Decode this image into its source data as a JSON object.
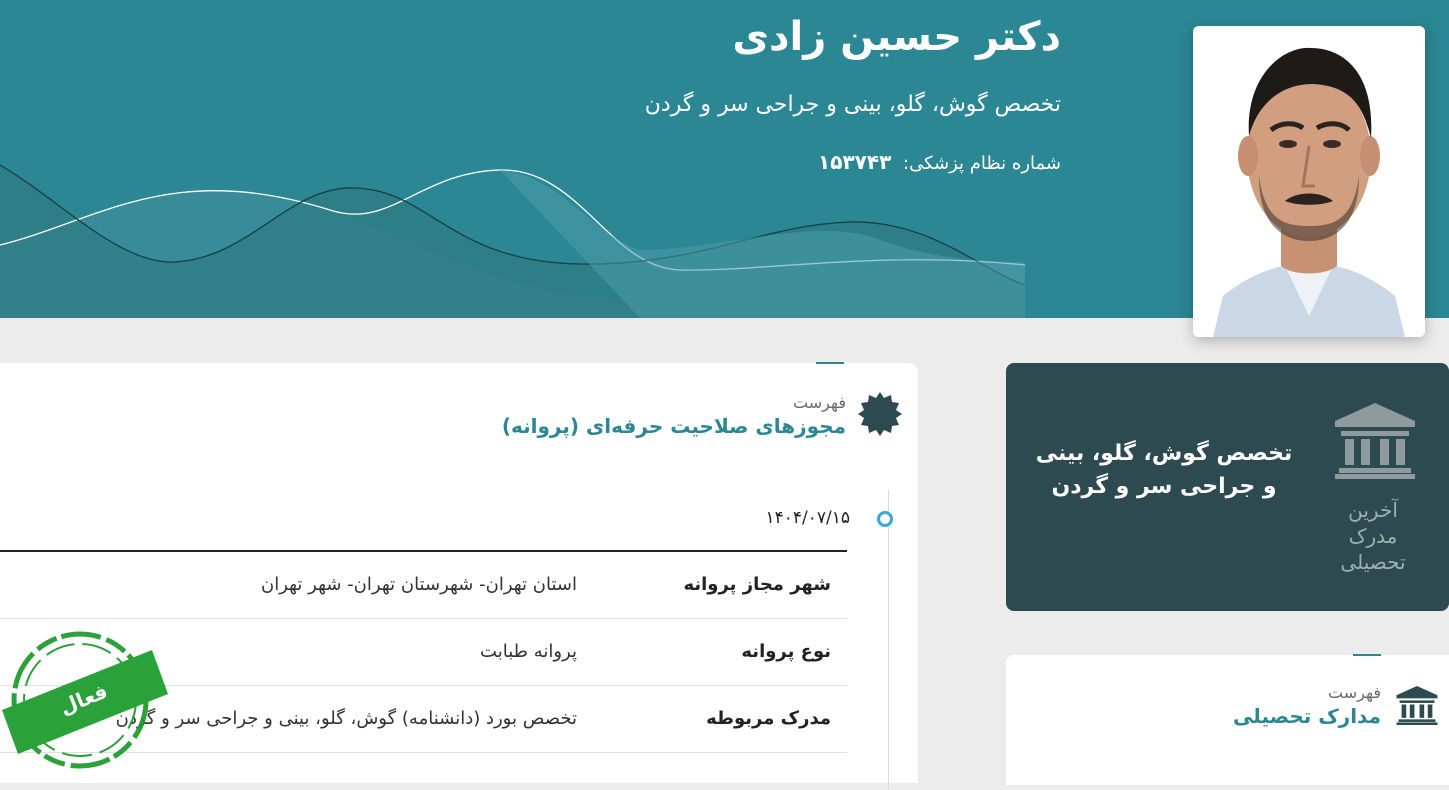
{
  "doctor": {
    "name": "دکتر حسین زادی",
    "specialty": "تخصص گوش، گلو، بینی و جراحی سر و گردن",
    "medical_code_label": "شماره نظام پزشکی:",
    "medical_code": "۱۵۳۷۴۳"
  },
  "degree_card": {
    "label": "آخرین مدرک تحصیلی",
    "text": "تخصص گوش، گلو، بینی و جراحی سر و گردن",
    "icon": "institution-icon"
  },
  "license_section": {
    "subtitle": "فهرست",
    "title": "مجوزهای صلاحیت حرفه‌ای (پروانه)",
    "icon": "badge-icon",
    "date": "۱۴۰۴/۰۷/۱۵",
    "rows": [
      {
        "key": "شهر مجاز پروانه",
        "value": "استان تهران- شهرستان تهران- شهر تهران"
      },
      {
        "key": "نوع پروانه",
        "value": "پروانه طبابت"
      },
      {
        "key": "مدرک مربوطه",
        "value": "تخصص بورد (دانشنامه) گوش، گلو، بینی و جراحی سر و گردن"
      }
    ],
    "stamp_text": "فعال"
  },
  "education_section": {
    "subtitle": "فهرست",
    "title": "مدارک تحصیلی",
    "icon": "institution-icon"
  },
  "colors": {
    "header_bg": "#2b8794",
    "degree_card_bg": "#2c4a50",
    "accent": "#2b8794",
    "stamp_green": "#1a9a2a"
  }
}
